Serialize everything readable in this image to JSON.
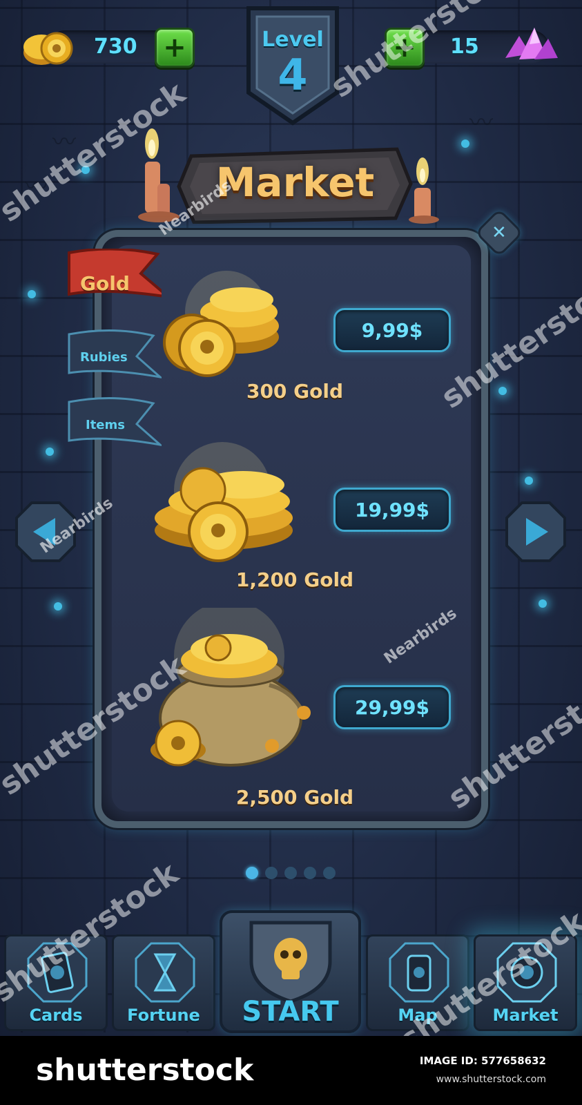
{
  "top_bar": {
    "gold_value": "730",
    "gems_value": "15",
    "level_label": "Level",
    "level_number": "4"
  },
  "market": {
    "title": "Market",
    "tabs": [
      {
        "label": "Gold",
        "active": true
      },
      {
        "label": "Rubies",
        "active": false
      },
      {
        "label": "Items",
        "active": false
      }
    ],
    "offers": [
      {
        "price": "9,99$",
        "amount": "300 Gold"
      },
      {
        "price": "19,99$",
        "amount": "1,200 Gold"
      },
      {
        "price": "29,99$",
        "amount": "2,500 Gold"
      }
    ],
    "page_count": 5,
    "page_active": 1
  },
  "bottom_nav": {
    "cards": "Cards",
    "fortune": "Fortune",
    "start": "START",
    "map": "Map",
    "market": "Market"
  },
  "footer": {
    "logo": "shutterstock",
    "image_id": "IMAGE ID: 577658632",
    "url": "www.shutterstock.com"
  },
  "watermarks": {
    "brand": "shutterstock",
    "author": "Nearbirds"
  },
  "colors": {
    "accent_cyan": "#5fe0ff",
    "gold_text": "#f6c56d",
    "tab_active": "#c0392b",
    "plus_green": "#4cbf2f"
  },
  "icons": [
    "gold-coins-icon",
    "plus-icon",
    "crystal-gem-icon",
    "candle-icon",
    "close-icon",
    "arrow-left-icon",
    "arrow-right-icon",
    "card-icon",
    "hourglass-icon",
    "skull-shield-icon",
    "map-icon",
    "market-icon"
  ]
}
